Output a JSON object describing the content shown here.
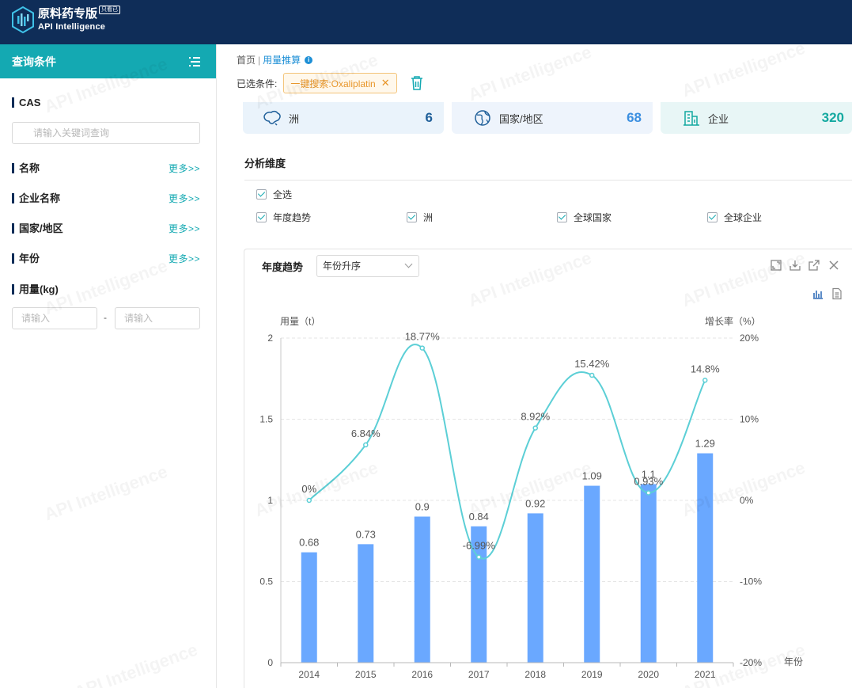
{
  "header": {
    "brand_title": "原料药专版",
    "brand_badge": "只看已",
    "brand_sub": "API Intelligence"
  },
  "sidebar": {
    "title": "查询条件",
    "sections": [
      {
        "label": "CAS"
      },
      {
        "label": "名称",
        "more": "更多>>"
      },
      {
        "label": "企业名称",
        "more": "更多>>"
      },
      {
        "label": "国家/地区",
        "more": "更多>>"
      },
      {
        "label": "年份",
        "more": "更多>>"
      },
      {
        "label": "用量(kg)"
      }
    ],
    "cas_placeholder": "请输入关键词查询",
    "range_min_placeholder": "请输入",
    "range_separator": "-",
    "range_max_placeholder": "请输入"
  },
  "breadcrumb": {
    "home": "首页",
    "sep": "|",
    "current": "用量推算"
  },
  "filters": {
    "label": "已选条件:",
    "tag": "一键搜索:Oxaliplatin"
  },
  "stats": [
    {
      "label": "洲",
      "value": "6",
      "color": "#1f5f99",
      "bg": "#eaf3fb"
    },
    {
      "label": "国家/地区",
      "value": "68",
      "color": "#3b8fe0",
      "bg": "#eef4fc"
    },
    {
      "label": "企业",
      "value": "320",
      "color": "#14a9a0",
      "bg": "#e8f6f6"
    }
  ],
  "analysis": {
    "title": "分析维度",
    "select_all": "全选",
    "options": [
      "年度趋势",
      "洲",
      "全球国家",
      "全球企业"
    ]
  },
  "panel": {
    "title": "年度趋势",
    "sort_value": "年份升序"
  },
  "watermark": "API Intelligence",
  "chart_data": {
    "type": "bar",
    "categories": [
      "2014",
      "2015",
      "2016",
      "2017",
      "2018",
      "2019",
      "2020",
      "2021"
    ],
    "series": [
      {
        "type": "bar",
        "values": [
          0.68,
          0.73,
          0.9,
          0.84,
          0.92,
          1.09,
          1.1,
          1.29
        ],
        "labels": [
          "0.68",
          "0.73",
          "0.9",
          "0.84",
          "0.92",
          "1.09",
          "1.1",
          "1.29"
        ],
        "color": "#6aa8ff"
      },
      {
        "type": "line",
        "values": [
          0,
          6.84,
          18.77,
          -6.99,
          8.92,
          15.42,
          0.93,
          14.8
        ],
        "labels": [
          "0%",
          "6.84%",
          "18.77%",
          "-6.99%",
          "8.92%",
          "15.42%",
          "0.93%",
          "14.8%"
        ],
        "color": "#5ccfd6"
      }
    ],
    "ylabel_left": "用量（t）",
    "ylabel_right": "增长率（%）",
    "xlabel": "年份",
    "ylim_left": [
      0,
      2
    ],
    "yticks_left": [
      "0",
      "0.5",
      "1",
      "1.5",
      "2"
    ],
    "ylim_right": [
      -20,
      20
    ],
    "yticks_right": [
      "-20%",
      "-10%",
      "0%",
      "10%",
      "20%"
    ],
    "grid": true
  }
}
